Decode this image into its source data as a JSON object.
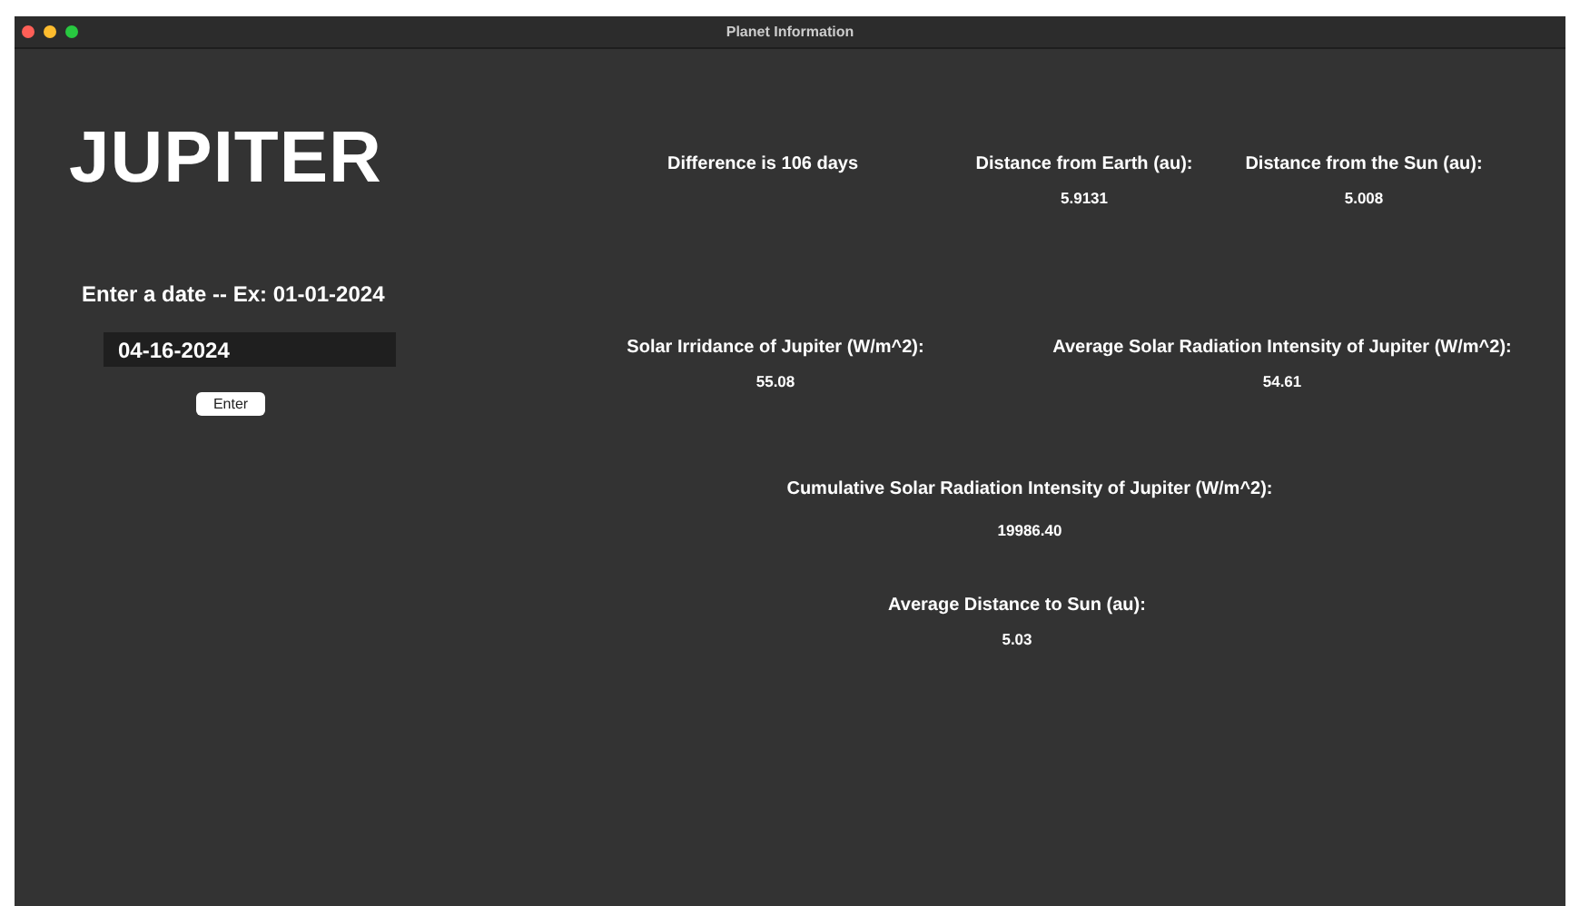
{
  "window": {
    "title": "Planet Information"
  },
  "planet": "JUPITER",
  "date_prompt": "Enter a date -- Ex: 01-01-2024",
  "date_field": {
    "value": "04-16-2024"
  },
  "enter_button": "Enter",
  "rows": [
    {
      "stats": [
        {
          "label": "Difference is 106 days"
        },
        {
          "label": "Distance from Earth (au):",
          "value": "5.9131"
        },
        {
          "label": "Distance from the Sun (au):",
          "value": "5.008"
        }
      ]
    },
    {
      "stats": [
        {
          "label": "Solar Irridance of Jupiter (W/m^2):",
          "value": "55.08"
        },
        {
          "label": "Average Solar Radiation Intensity of Jupiter (W/m^2):",
          "value": "54.61"
        }
      ]
    },
    {
      "stats": [
        {
          "label": "Cumulative Solar Radiation Intensity of Jupiter (W/m^2):",
          "value": "19986.40"
        }
      ]
    },
    {
      "stats": [
        {
          "label": "Average Distance to Sun (au):",
          "value": "5.03"
        }
      ]
    }
  ]
}
